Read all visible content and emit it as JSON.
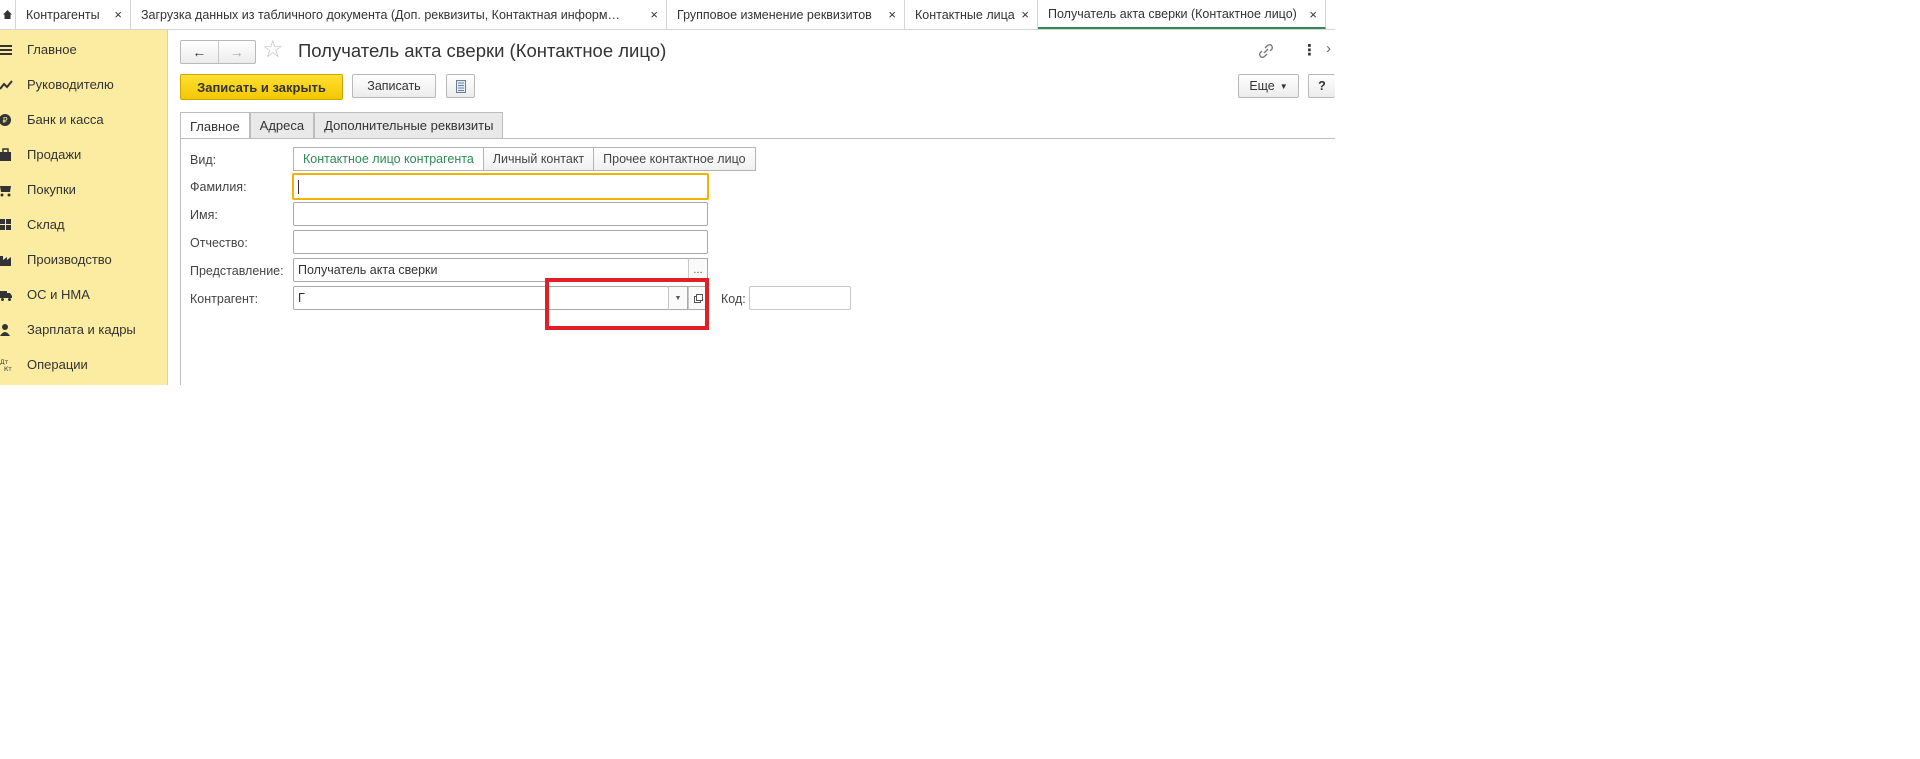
{
  "tabs": [
    {
      "label": "Контрагенты",
      "close": "×"
    },
    {
      "label": "Загрузка данных из табличного документа (Доп. реквизиты, Контактная информ…",
      "close": "×"
    },
    {
      "label": "Групповое изменение реквизитов",
      "close": "×"
    },
    {
      "label": "Контактные лица",
      "close": "×"
    },
    {
      "label": "Получатель акта сверки (Контактное лицо)",
      "close": "×",
      "active": true
    }
  ],
  "sidebar": {
    "items": [
      {
        "label": "Главное",
        "icon": "menu-icon"
      },
      {
        "label": "Руководителю",
        "icon": "chart-trend-icon"
      },
      {
        "label": "Банк и касса",
        "icon": "ruble-coin-icon"
      },
      {
        "label": "Продажи",
        "icon": "shopping-bag-icon"
      },
      {
        "label": "Покупки",
        "icon": "cart-icon"
      },
      {
        "label": "Склад",
        "icon": "grid-icon"
      },
      {
        "label": "Производство",
        "icon": "factory-icon"
      },
      {
        "label": "ОС и НМА",
        "icon": "truck-icon"
      },
      {
        "label": "Зарплата и кадры",
        "icon": "person-icon"
      },
      {
        "label": "Операции",
        "icon": "dt-kt-icon"
      }
    ],
    "background": "#fbeca2"
  },
  "form": {
    "title": "Получатель акта сверки (Контактное лицо)",
    "toolbar": {
      "save_close_label": "Записать и закрыть",
      "save_label": "Записать",
      "more_label": "Еще",
      "help_label": "?"
    },
    "tabs": [
      "Главное",
      "Адреса",
      "Дополнительные реквизиты"
    ],
    "fields": {
      "kind_label": "Вид:",
      "kind_options": [
        "Контактное лицо контрагента",
        "Личный контакт",
        "Прочее контактное лицо"
      ],
      "lastname_label": "Фамилия:",
      "lastname_value": "",
      "firstname_label": "Имя:",
      "firstname_value": "",
      "middlename_label": "Отчество:",
      "middlename_value": "",
      "presentation_label": "Представление:",
      "presentation_value": "Получатель акта сверки",
      "presentation_button": "...",
      "counterparty_label": "Контрагент:",
      "counterparty_value": "Г",
      "code_label": "Код:",
      "code_value": ""
    },
    "accent_color": "#2f8a57",
    "primary_button_color": "#f4c800",
    "highlight_color": "#e21f26"
  }
}
